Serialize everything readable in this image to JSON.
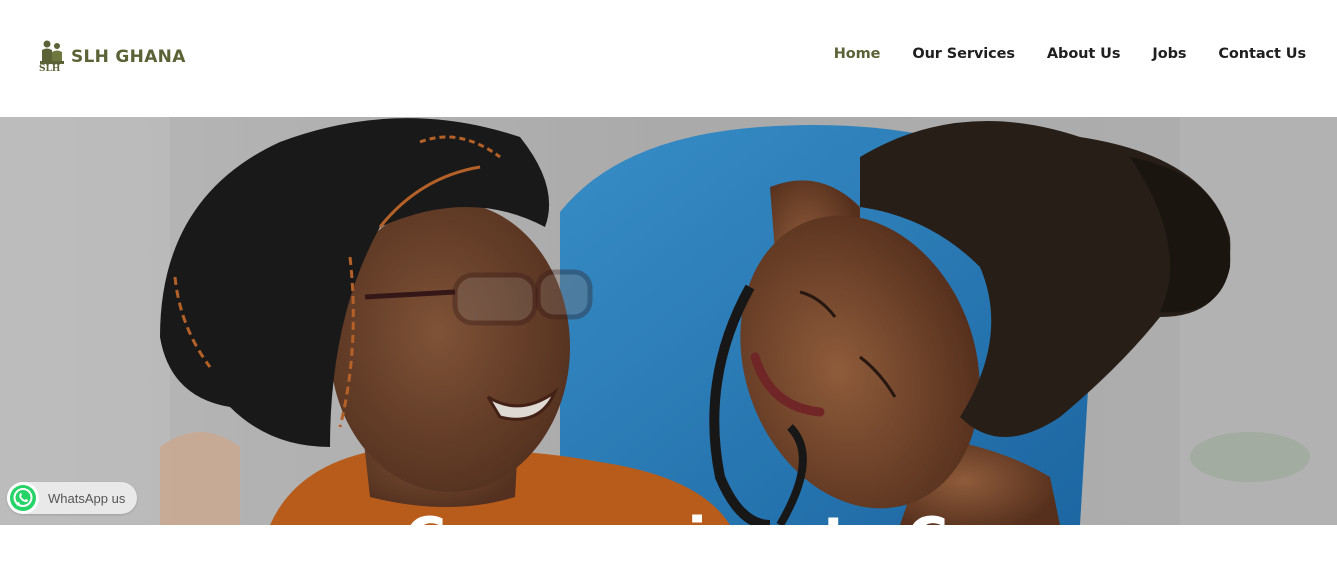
{
  "brand": {
    "name": "SLH GHANA",
    "monogram": "SLH",
    "color": "#5a6236"
  },
  "nav": {
    "items": [
      {
        "label": "Home",
        "active": true
      },
      {
        "label": "Our Services",
        "active": false
      },
      {
        "label": "About Us",
        "active": false
      },
      {
        "label": "Jobs",
        "active": false
      },
      {
        "label": "Contact Us",
        "active": false
      }
    ],
    "active_color": "#5a6236",
    "color": "#1f1f1f"
  },
  "hero": {
    "image": "caregiver-with-elderly-woman-photo",
    "headline_fragment": "Compassionate Care"
  },
  "whatsapp": {
    "label": "WhatsApp us",
    "icon": "whatsapp-icon",
    "color": "#25d366"
  }
}
